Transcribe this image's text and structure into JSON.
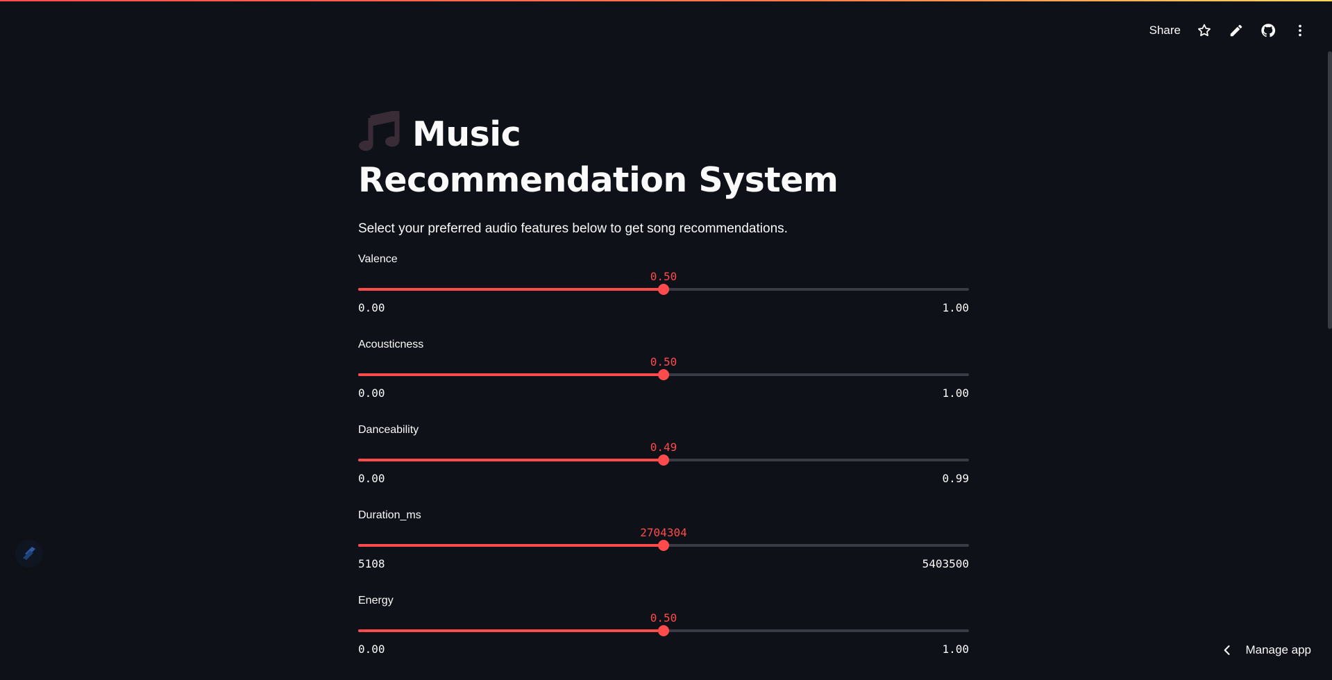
{
  "header": {
    "share_label": "Share",
    "icons": [
      "star-icon",
      "pencil-icon",
      "github-icon",
      "more-vert-icon"
    ]
  },
  "main": {
    "title_emoji": "music-notes-icon",
    "title": "Music Recommendation System",
    "description": "Select your preferred audio features below to get song recommendations."
  },
  "sliders": [
    {
      "label": "Valence",
      "value": "0.50",
      "min": "0.00",
      "max": "1.00",
      "fraction": 0.5
    },
    {
      "label": "Acousticness",
      "value": "0.50",
      "min": "0.00",
      "max": "1.00",
      "fraction": 0.5
    },
    {
      "label": "Danceability",
      "value": "0.49",
      "min": "0.00",
      "max": "0.99",
      "fraction": 0.5
    },
    {
      "label": "Duration_ms",
      "value": "2704304",
      "min": "5108",
      "max": "5403500",
      "fraction": 0.5
    },
    {
      "label": "Energy",
      "value": "0.50",
      "min": "0.00",
      "max": "1.00",
      "fraction": 0.5
    }
  ],
  "footer": {
    "manage_label": "Manage app"
  },
  "colors": {
    "accent": "#ff4b4b",
    "background": "#0e1117",
    "track": "#3a3b44",
    "text": "#fafafa"
  }
}
